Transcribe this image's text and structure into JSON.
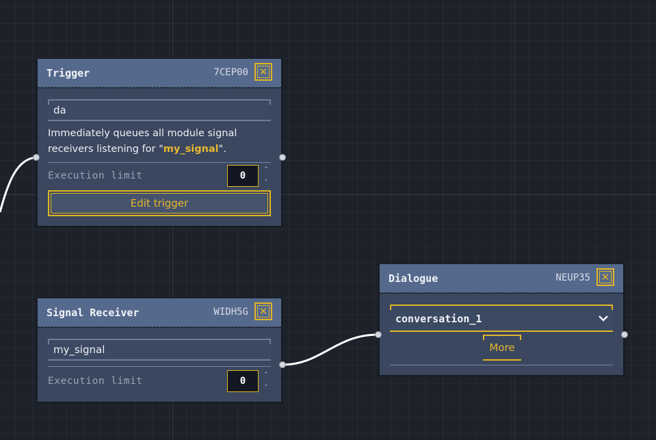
{
  "nodes": {
    "trigger": {
      "title": "Trigger",
      "id": "7CEP00",
      "close_glyph": "✕",
      "name_value": "da",
      "description_before": "Immediately queues all module signal receivers listening for \"",
      "description_signal": "my_signal",
      "description_after": "\".",
      "execution_limit_label": "Execution limit",
      "execution_limit_value": "0",
      "edit_button_label": "Edit trigger"
    },
    "signal_receiver": {
      "title": "Signal Receiver",
      "id": "WIDH5G",
      "close_glyph": "✕",
      "signal_value": "my_signal",
      "execution_limit_label": "Execution limit",
      "execution_limit_value": "0"
    },
    "dialogue": {
      "title": "Dialogue",
      "id": "NEUP35",
      "close_glyph": "✕",
      "conversation_value": "conversation_1",
      "more_button_label": "More"
    }
  },
  "icons": {
    "close": "close-icon",
    "spinner": "spinner-arrows-icon",
    "dropdown": "chevron-down-icon"
  },
  "spinner_up": "⌃",
  "spinner_down": "⌄",
  "colors": {
    "canvas_background": "#1c212a",
    "node_header": "#55698d",
    "node_body": "#3a475f",
    "accent": "#e2b623",
    "signal_highlight": "#e8b82c",
    "connection": "#ffffff"
  }
}
